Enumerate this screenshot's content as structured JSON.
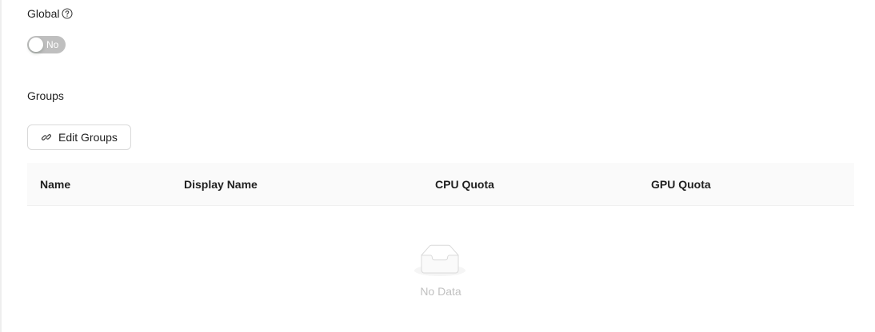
{
  "global": {
    "label": "Global",
    "toggle": {
      "state_label": "No",
      "checked": false
    }
  },
  "groups": {
    "label": "Groups",
    "edit_button_label": "Edit Groups"
  },
  "table": {
    "columns": [
      "Name",
      "Display Name",
      "CPU Quota",
      "GPU Quota"
    ],
    "rows": [],
    "empty_text": "No Data"
  },
  "icons": {
    "help": "question-circle-icon",
    "edit": "link-icon",
    "empty": "empty-inbox-icon"
  }
}
